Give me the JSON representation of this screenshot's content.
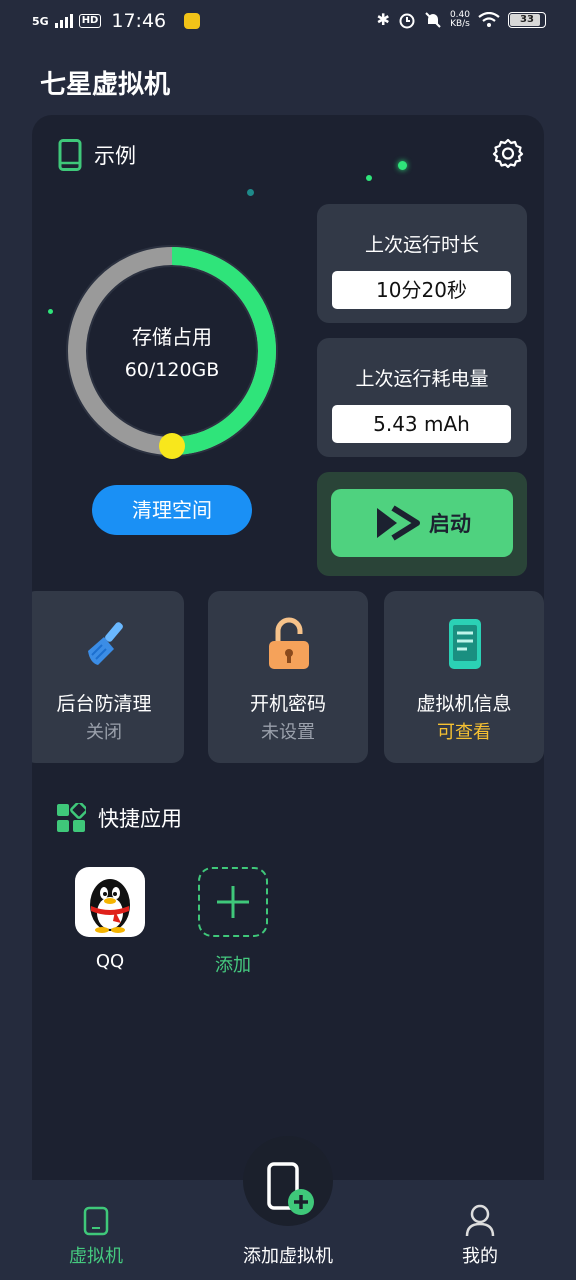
{
  "status_bar": {
    "network": "5G",
    "hd": "HD",
    "time": "17:46",
    "speed_value": "0.40",
    "speed_unit": "KB/s",
    "battery": "33"
  },
  "app_title": "七星虚拟机",
  "vm_card": {
    "name": "示例",
    "storage": {
      "label": "存储占用",
      "value_text": "60/120GB",
      "used": 60,
      "total": 120
    },
    "clean_button": "清理空间",
    "last_run_duration": {
      "title": "上次运行时长",
      "value": "10分20秒"
    },
    "last_run_power": {
      "title": "上次运行耗电量",
      "value": "5.43  mAh"
    },
    "start_button": "启动"
  },
  "features": [
    {
      "name": "后台防清理",
      "status": "关闭",
      "icon": "broom-icon"
    },
    {
      "name": "开机密码",
      "status": "未设置",
      "icon": "unlock-icon"
    },
    {
      "name": "虚拟机信息",
      "status": "可查看",
      "icon": "phone-info-icon"
    }
  ],
  "quick_apps": {
    "title": "快捷应用",
    "apps": [
      {
        "label": "QQ",
        "icon": "qq-penguin-icon"
      }
    ],
    "add_label": "添加"
  },
  "bottom_nav": {
    "items": [
      {
        "label": "虚拟机",
        "active": true
      },
      {
        "label": "添加虚拟机",
        "active": false
      },
      {
        "label": "我的",
        "active": false
      }
    ]
  },
  "colors": {
    "accent_green": "#2fe47a",
    "ring_track": "#9a9a9a",
    "ring_knob": "#f8e71c",
    "clean_button": "#1a90f5",
    "status_accent": "#f6c132"
  }
}
